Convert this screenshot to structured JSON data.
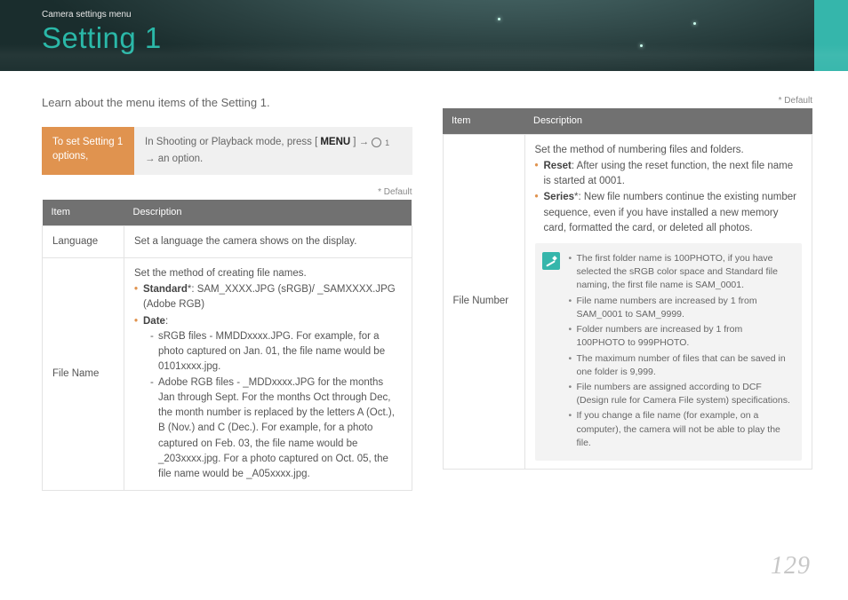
{
  "header": {
    "breadcrumb": "Camera settings menu",
    "title": "Setting 1"
  },
  "intro": "Learn about the menu items of the Setting 1.",
  "callout": {
    "left": "To set Setting 1 options,",
    "r1": "In Shooting or Playback mode, press [",
    "menu": "MENU",
    "r2": "] →",
    "r3": "→ an option."
  },
  "default_note": "* Default",
  "table_headers": {
    "item": "Item",
    "desc": "Description"
  },
  "left_table": {
    "language": {
      "item": "Language",
      "desc": "Set a language the camera shows on the display."
    },
    "filename": {
      "item": "File Name",
      "intro": "Set the method of creating file names.",
      "standard_label": "Standard",
      "standard_rest": "*: SAM_XXXX.JPG (sRGB)/ _SAMXXXX.JPG (Adobe RGB)",
      "date_label": "Date",
      "date_colon": ":",
      "sub1": "sRGB files - MMDDxxxx.JPG. For example, for a photo captured on Jan. 01, the file name would be 0101xxxx.jpg.",
      "sub2": "Adobe RGB files - _MDDxxxx.JPG for the months Jan through Sept. For the months Oct through Dec, the month number is replaced by the letters A (Oct.), B (Nov.) and C (Dec.).",
      "sub2b": "For example, for a photo captured on Feb. 03, the file name would be _203xxxx.jpg. For a photo captured on Oct. 05, the file name would be _A05xxxx.jpg."
    }
  },
  "right_table": {
    "filenumber": {
      "item": "File Number",
      "intro": "Set the method of numbering files and folders.",
      "reset_label": "Reset",
      "reset_rest": ": After using the reset function, the next file name is started at 0001.",
      "series_label": "Series",
      "series_rest": "*: New file numbers continue the existing number sequence, even if you have installed a new memory card, formatted the card, or deleted all photos.",
      "notes": {
        "n1": "The first folder name is 100PHOTO, if you have selected the sRGB color space and Standard file naming, the first file name is SAM_0001.",
        "n2": "File name numbers are increased by 1 from SAM_0001 to SAM_9999.",
        "n3": "Folder numbers are increased by 1 from 100PHOTO to 999PHOTO.",
        "n4": "The maximum number of files that can be saved in one folder is 9,999.",
        "n5": "File numbers are assigned according to DCF (Design rule for Camera File system) specifications.",
        "n6": "If you change a file name (for example, on a computer), the camera will not be able to play the file."
      }
    }
  },
  "page_number": "129"
}
